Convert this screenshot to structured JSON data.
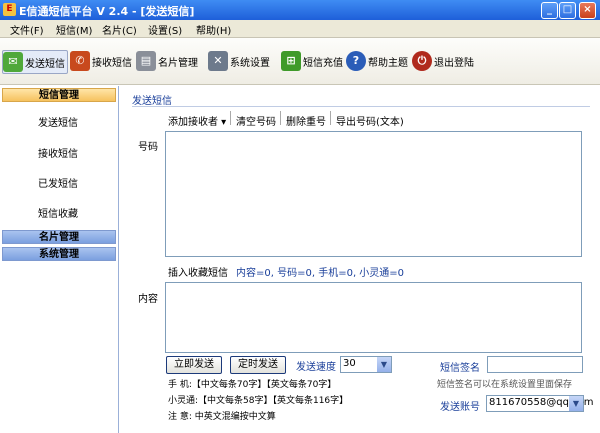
{
  "window": {
    "title": "E信通短信平台 V  2.4 - [发送短信]"
  },
  "menu": [
    "文件(F)",
    "短信(M)",
    "名片(C)",
    "设置(S)",
    "帮助(H)"
  ],
  "toolbar": [
    {
      "label": "发送短信",
      "icon": "send-sms-icon",
      "color": "#4fa83a"
    },
    {
      "label": "接收短信",
      "icon": "receive-sms-icon",
      "color": "#c8491d"
    },
    {
      "label": "名片管理",
      "icon": "card-icon",
      "color": "#8a8f99"
    },
    {
      "label": "系统设置",
      "icon": "tools-icon",
      "color": "#6d7a8c"
    },
    {
      "label": "短信充值",
      "icon": "cart-icon",
      "color": "#3f9a2a"
    },
    {
      "label": "帮助主题",
      "icon": "help-icon",
      "color": "#2b5db8"
    },
    {
      "label": "退出登陆",
      "icon": "power-icon",
      "color": "#b02a1d"
    }
  ],
  "sidebar": {
    "groups": [
      "短信管理",
      "名片管理",
      "系统管理"
    ],
    "items": [
      "发送短信",
      "接收短信",
      "已发短信",
      "短信收藏"
    ]
  },
  "main": {
    "section": "发送短信",
    "options": [
      "添加接收者 ▾",
      "清空号码",
      "删除重号",
      "导出号码(文本)"
    ],
    "number_label": "号码",
    "insert_fav": "插入收藏短信",
    "counts": "内容=0, 号码=0, 手机=0, 小灵通=0",
    "content_label": "内容",
    "send_now": "立即发送",
    "send_timed": "定时发送",
    "speed_label": "发送速度",
    "speed_value": "30",
    "sign_label": "短信签名",
    "sign_hint": "短信签名可以在系统设置里面保存",
    "account_label": "发送账号",
    "account_value": "811670558@qq.com",
    "note1": "手  机:【中文每条70字】【英文每条70字】",
    "note2": "小灵通:【中文每条58字】【英文每条116字】",
    "note3": "注  意: 中英文混编按中文算"
  }
}
